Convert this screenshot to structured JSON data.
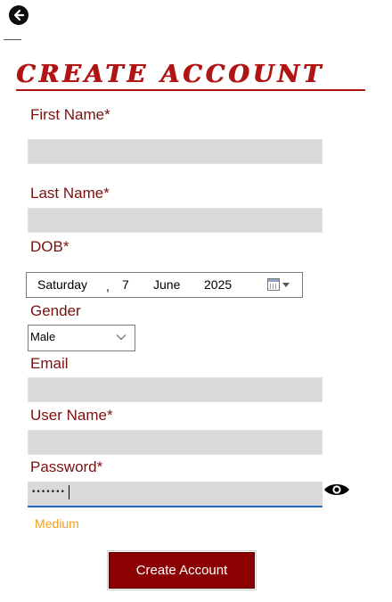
{
  "header": {
    "back_icon": "arrow-left-circle-icon",
    "title": "CREATE ACCOUNT"
  },
  "form": {
    "first_name": {
      "label": "First Name*",
      "value": ""
    },
    "last_name": {
      "label": "Last Name*",
      "value": ""
    },
    "dob": {
      "label": "DOB*",
      "weekday": "Saturday",
      "separator": ",",
      "day": "7",
      "month": "June",
      "year": "2025",
      "button_icon": "calendar-dropdown-icon"
    },
    "gender": {
      "label": "Gender",
      "selected": "Male",
      "dropdown_icon": "chevron-down-icon"
    },
    "email": {
      "label": "Email",
      "value": ""
    },
    "user_name": {
      "label": "User Name*",
      "value": ""
    },
    "password": {
      "label": "Password*",
      "masked_value": "•••••••",
      "strength": "Medium",
      "toggle_icon": "eye-icon"
    },
    "submit_label": "Create Account"
  },
  "colors": {
    "title": "#b01414",
    "label": "#7a1010",
    "field_bg": "#d9d9d9",
    "focus_border": "#1f6fc2",
    "strength_medium": "#f2a01a",
    "button_bg": "#8b0000"
  }
}
